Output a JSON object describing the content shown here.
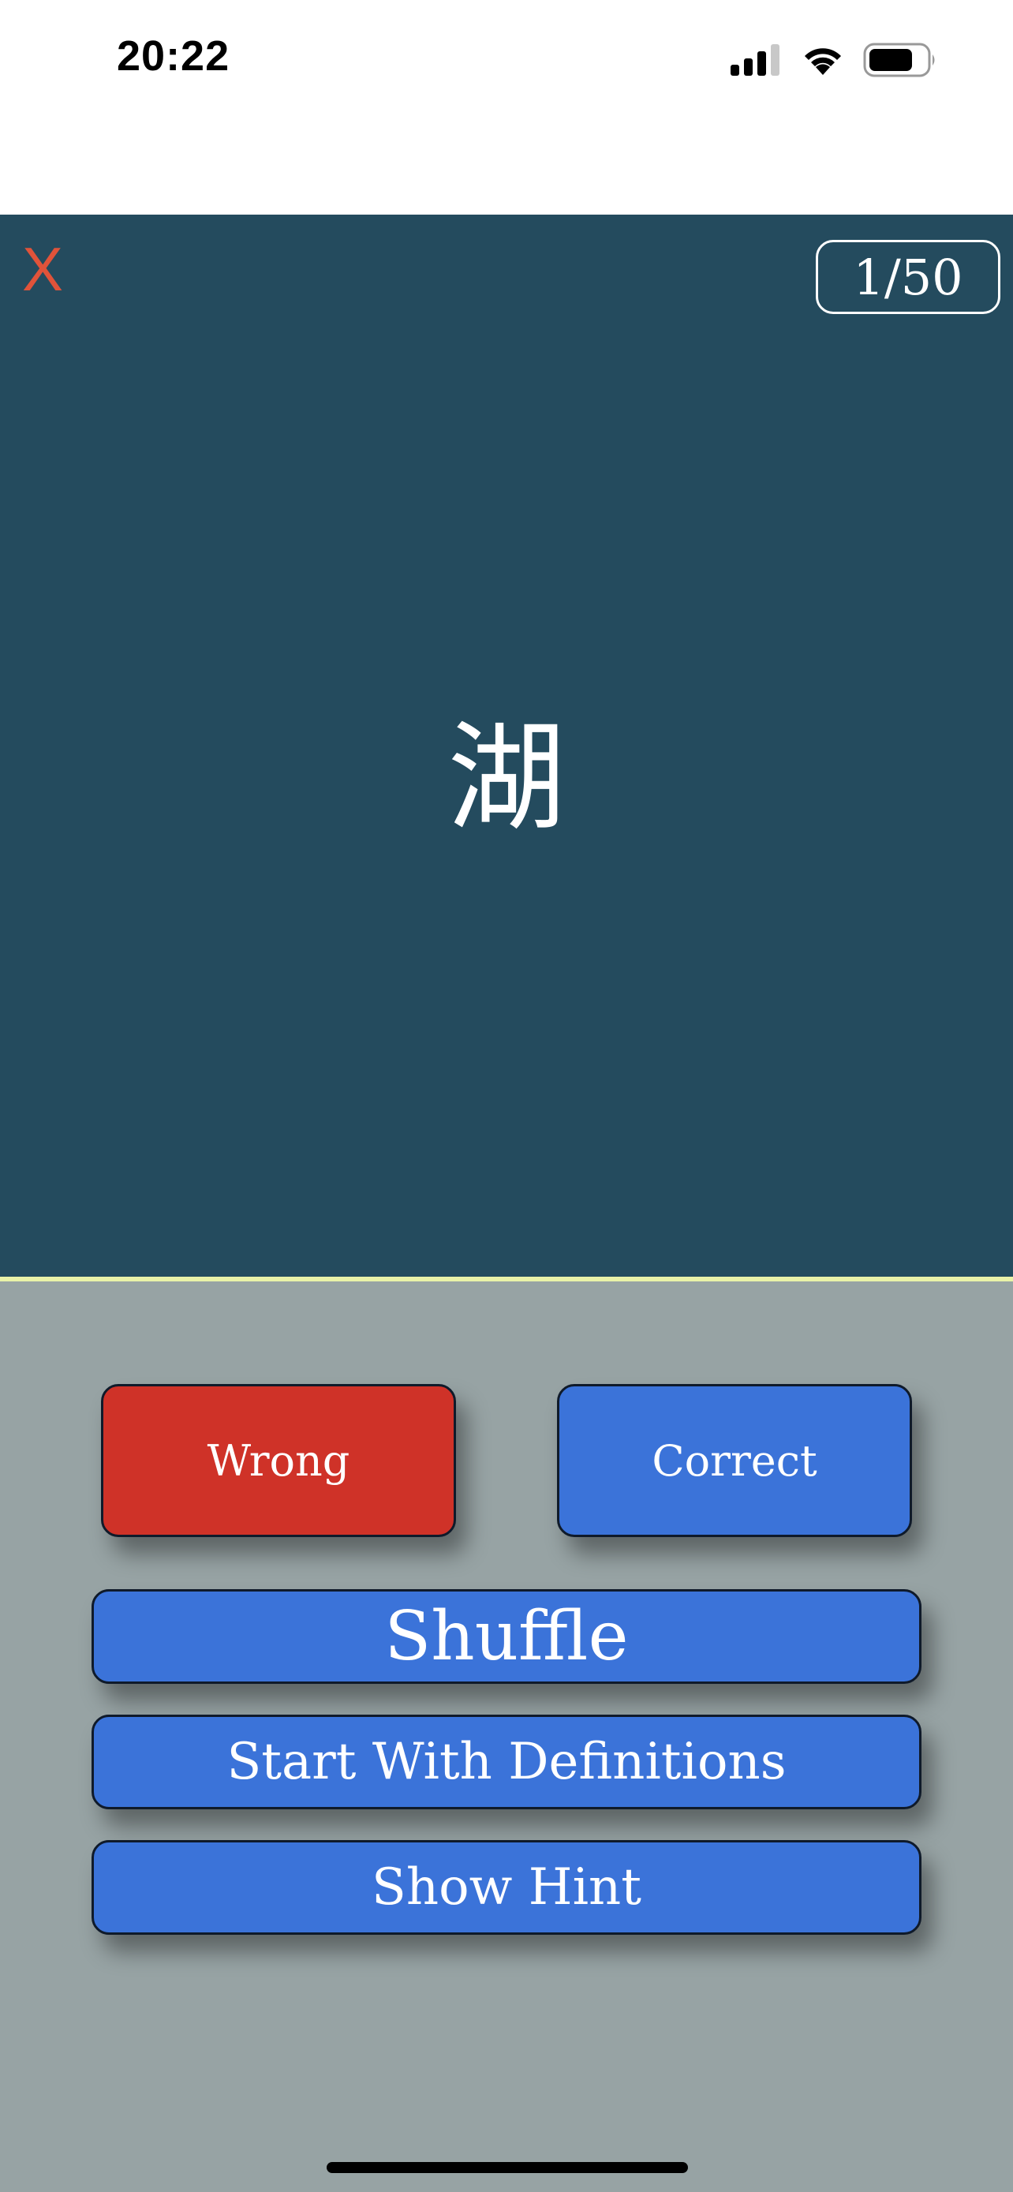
{
  "status_bar": {
    "time": "20:22",
    "icons": [
      "cellular-signal-icon",
      "wifi-icon",
      "battery-icon"
    ]
  },
  "card": {
    "close_label": "X",
    "counter": "1/50",
    "term": "湖"
  },
  "buttons": {
    "wrong": "Wrong",
    "correct": "Correct",
    "shuffle": "Shuffle",
    "start_with_definitions": "Start With Definitions",
    "show_hint": "Show Hint"
  },
  "colors": {
    "card_background": "#244b5e",
    "page_background": "#97a3a4",
    "wrong_button": "#cf3228",
    "action_button": "#3b73d9",
    "close_x": "#e0533a",
    "divider": "#e9f2a8"
  }
}
